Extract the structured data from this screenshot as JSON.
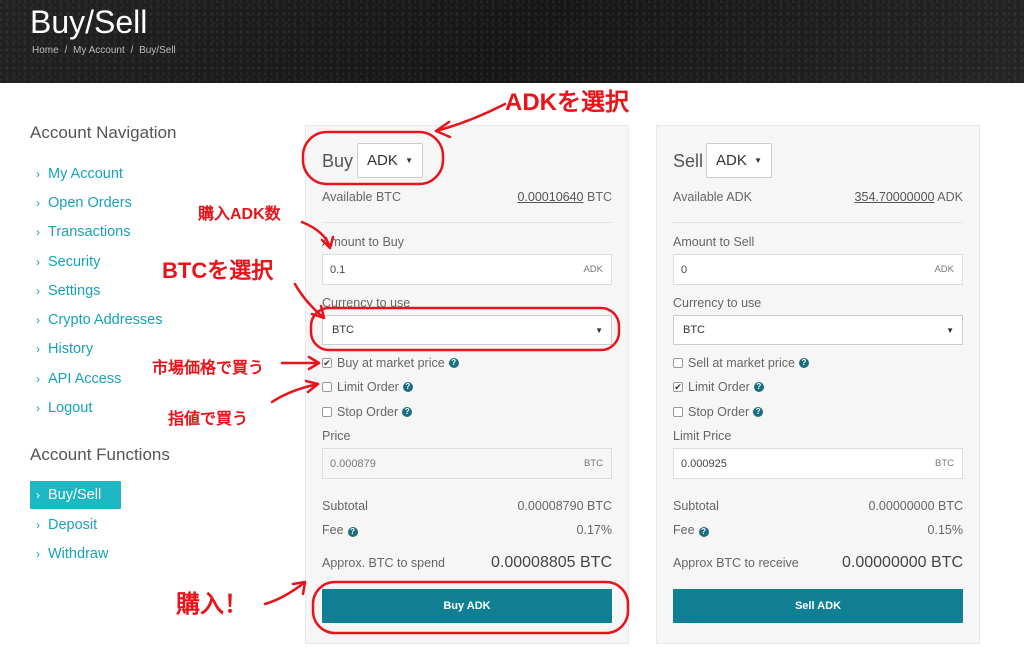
{
  "header": {
    "title": "Buy/Sell",
    "breadcrumb": [
      "Home",
      "/",
      "My Account",
      "/",
      "Buy/Sell"
    ]
  },
  "sidebar": {
    "nav_heading": "Account Navigation",
    "nav_items": [
      "My Account",
      "Open Orders",
      "Transactions",
      "Security",
      "Settings",
      "Crypto Addresses",
      "History",
      "API Access",
      "Logout"
    ],
    "functions_heading": "Account Functions",
    "function_items": [
      "Buy/Sell",
      "Deposit",
      "Withdraw"
    ],
    "active_item": "Buy/Sell",
    "chevron": "›"
  },
  "buy": {
    "title": "Buy",
    "coin": "ADK",
    "available_label": "Available BTC",
    "available_value": "0.00010640",
    "available_unit": "BTC",
    "amount_label": "Amount to Buy",
    "amount_value": "0.1",
    "amount_unit": "ADK",
    "currency_label": "Currency to use",
    "currency_value": "BTC",
    "market_label": "Buy at market price",
    "limit_label": "Limit Order",
    "stop_label": "Stop Order",
    "market_checked": true,
    "limit_checked": false,
    "stop_checked": false,
    "price_label": "Price",
    "price_value": "0.000879",
    "price_unit": "BTC",
    "subtotal_label": "Subtotal",
    "subtotal_value": "0.00008790 BTC",
    "fee_label": "Fee",
    "fee_value": "0.17%",
    "approx_label": "Approx. BTC to spend",
    "approx_value": "0.00008805 BTC",
    "button_label": "Buy ADK"
  },
  "sell": {
    "title": "Sell",
    "coin": "ADK",
    "available_label": "Available ADK",
    "available_value": "354.70000000",
    "available_unit": "ADK",
    "amount_label": "Amount to Sell",
    "amount_value": "0",
    "amount_unit": "ADK",
    "currency_label": "Currency to use",
    "currency_value": "BTC",
    "market_label": "Sell at market price",
    "limit_label": "Limit Order",
    "stop_label": "Stop Order",
    "market_checked": false,
    "limit_checked": true,
    "stop_checked": false,
    "price_label": "Limit Price",
    "price_value": "0.000925",
    "price_unit": "BTC",
    "subtotal_label": "Subtotal",
    "subtotal_value": "0.00000000 BTC",
    "fee_label": "Fee",
    "fee_value": "0.15%",
    "approx_label": "Approx BTC to receive",
    "approx_value": "0.00000000 BTC",
    "button_label": "Sell ADK"
  },
  "annotations": {
    "select_adk": "ADKを選択",
    "buy_amount": "購入ADK数",
    "select_btc": "BTCを選択",
    "market_buy": "市場価格で買う",
    "limit_buy": "指値で買う",
    "purchase": "購入！"
  },
  "icons": {
    "caret": "▼",
    "check": "✔",
    "question": "?"
  },
  "colors": {
    "link": "#16a3b8",
    "active_bg": "#1eb7c4",
    "button": "#117f93",
    "annotation": "#e8141b",
    "help_icon": "#1b6e80"
  }
}
